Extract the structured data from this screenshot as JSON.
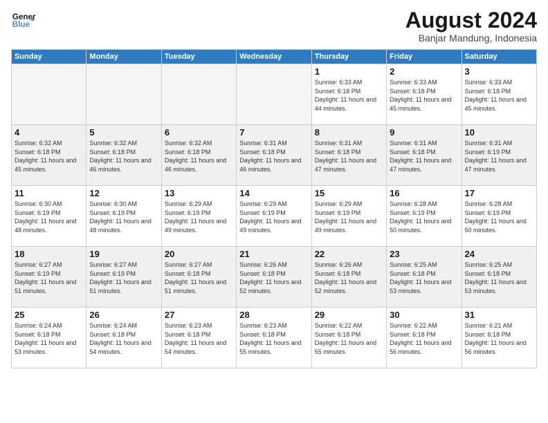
{
  "header": {
    "logo_line1": "General",
    "logo_line2": "Blue",
    "month_title": "August 2024",
    "subtitle": "Banjar Mandung, Indonesia"
  },
  "weekdays": [
    "Sunday",
    "Monday",
    "Tuesday",
    "Wednesday",
    "Thursday",
    "Friday",
    "Saturday"
  ],
  "weeks": [
    [
      {
        "day": "",
        "empty": true
      },
      {
        "day": "",
        "empty": true
      },
      {
        "day": "",
        "empty": true
      },
      {
        "day": "",
        "empty": true
      },
      {
        "day": "1",
        "sunrise": "6:33 AM",
        "sunset": "6:18 PM",
        "daylight": "11 hours and 44 minutes."
      },
      {
        "day": "2",
        "sunrise": "6:33 AM",
        "sunset": "6:18 PM",
        "daylight": "11 hours and 45 minutes."
      },
      {
        "day": "3",
        "sunrise": "6:33 AM",
        "sunset": "6:18 PM",
        "daylight": "11 hours and 45 minutes."
      }
    ],
    [
      {
        "day": "4",
        "sunrise": "6:32 AM",
        "sunset": "6:18 PM",
        "daylight": "11 hours and 45 minutes."
      },
      {
        "day": "5",
        "sunrise": "6:32 AM",
        "sunset": "6:18 PM",
        "daylight": "11 hours and 46 minutes."
      },
      {
        "day": "6",
        "sunrise": "6:32 AM",
        "sunset": "6:18 PM",
        "daylight": "11 hours and 46 minutes."
      },
      {
        "day": "7",
        "sunrise": "6:31 AM",
        "sunset": "6:18 PM",
        "daylight": "11 hours and 46 minutes."
      },
      {
        "day": "8",
        "sunrise": "6:31 AM",
        "sunset": "6:18 PM",
        "daylight": "11 hours and 47 minutes."
      },
      {
        "day": "9",
        "sunrise": "6:31 AM",
        "sunset": "6:18 PM",
        "daylight": "11 hours and 47 minutes."
      },
      {
        "day": "10",
        "sunrise": "6:31 AM",
        "sunset": "6:19 PM",
        "daylight": "11 hours and 47 minutes."
      }
    ],
    [
      {
        "day": "11",
        "sunrise": "6:30 AM",
        "sunset": "6:19 PM",
        "daylight": "11 hours and 48 minutes."
      },
      {
        "day": "12",
        "sunrise": "6:30 AM",
        "sunset": "6:19 PM",
        "daylight": "11 hours and 48 minutes."
      },
      {
        "day": "13",
        "sunrise": "6:29 AM",
        "sunset": "6:19 PM",
        "daylight": "11 hours and 49 minutes."
      },
      {
        "day": "14",
        "sunrise": "6:29 AM",
        "sunset": "6:19 PM",
        "daylight": "11 hours and 49 minutes."
      },
      {
        "day": "15",
        "sunrise": "6:29 AM",
        "sunset": "6:19 PM",
        "daylight": "11 hours and 49 minutes."
      },
      {
        "day": "16",
        "sunrise": "6:28 AM",
        "sunset": "6:19 PM",
        "daylight": "11 hours and 50 minutes."
      },
      {
        "day": "17",
        "sunrise": "6:28 AM",
        "sunset": "6:19 PM",
        "daylight": "11 hours and 50 minutes."
      }
    ],
    [
      {
        "day": "18",
        "sunrise": "6:27 AM",
        "sunset": "6:19 PM",
        "daylight": "11 hours and 51 minutes."
      },
      {
        "day": "19",
        "sunrise": "6:27 AM",
        "sunset": "6:19 PM",
        "daylight": "11 hours and 51 minutes."
      },
      {
        "day": "20",
        "sunrise": "6:27 AM",
        "sunset": "6:18 PM",
        "daylight": "11 hours and 51 minutes."
      },
      {
        "day": "21",
        "sunrise": "6:26 AM",
        "sunset": "6:18 PM",
        "daylight": "11 hours and 52 minutes."
      },
      {
        "day": "22",
        "sunrise": "6:26 AM",
        "sunset": "6:18 PM",
        "daylight": "11 hours and 52 minutes."
      },
      {
        "day": "23",
        "sunrise": "6:25 AM",
        "sunset": "6:18 PM",
        "daylight": "11 hours and 53 minutes."
      },
      {
        "day": "24",
        "sunrise": "6:25 AM",
        "sunset": "6:18 PM",
        "daylight": "11 hours and 53 minutes."
      }
    ],
    [
      {
        "day": "25",
        "sunrise": "6:24 AM",
        "sunset": "6:18 PM",
        "daylight": "11 hours and 53 minutes."
      },
      {
        "day": "26",
        "sunrise": "6:24 AM",
        "sunset": "6:18 PM",
        "daylight": "11 hours and 54 minutes."
      },
      {
        "day": "27",
        "sunrise": "6:23 AM",
        "sunset": "6:18 PM",
        "daylight": "11 hours and 54 minutes."
      },
      {
        "day": "28",
        "sunrise": "6:23 AM",
        "sunset": "6:18 PM",
        "daylight": "11 hours and 55 minutes."
      },
      {
        "day": "29",
        "sunrise": "6:22 AM",
        "sunset": "6:18 PM",
        "daylight": "11 hours and 55 minutes."
      },
      {
        "day": "30",
        "sunrise": "6:22 AM",
        "sunset": "6:18 PM",
        "daylight": "11 hours and 56 minutes."
      },
      {
        "day": "31",
        "sunrise": "6:21 AM",
        "sunset": "6:18 PM",
        "daylight": "11 hours and 56 minutes."
      }
    ]
  ]
}
